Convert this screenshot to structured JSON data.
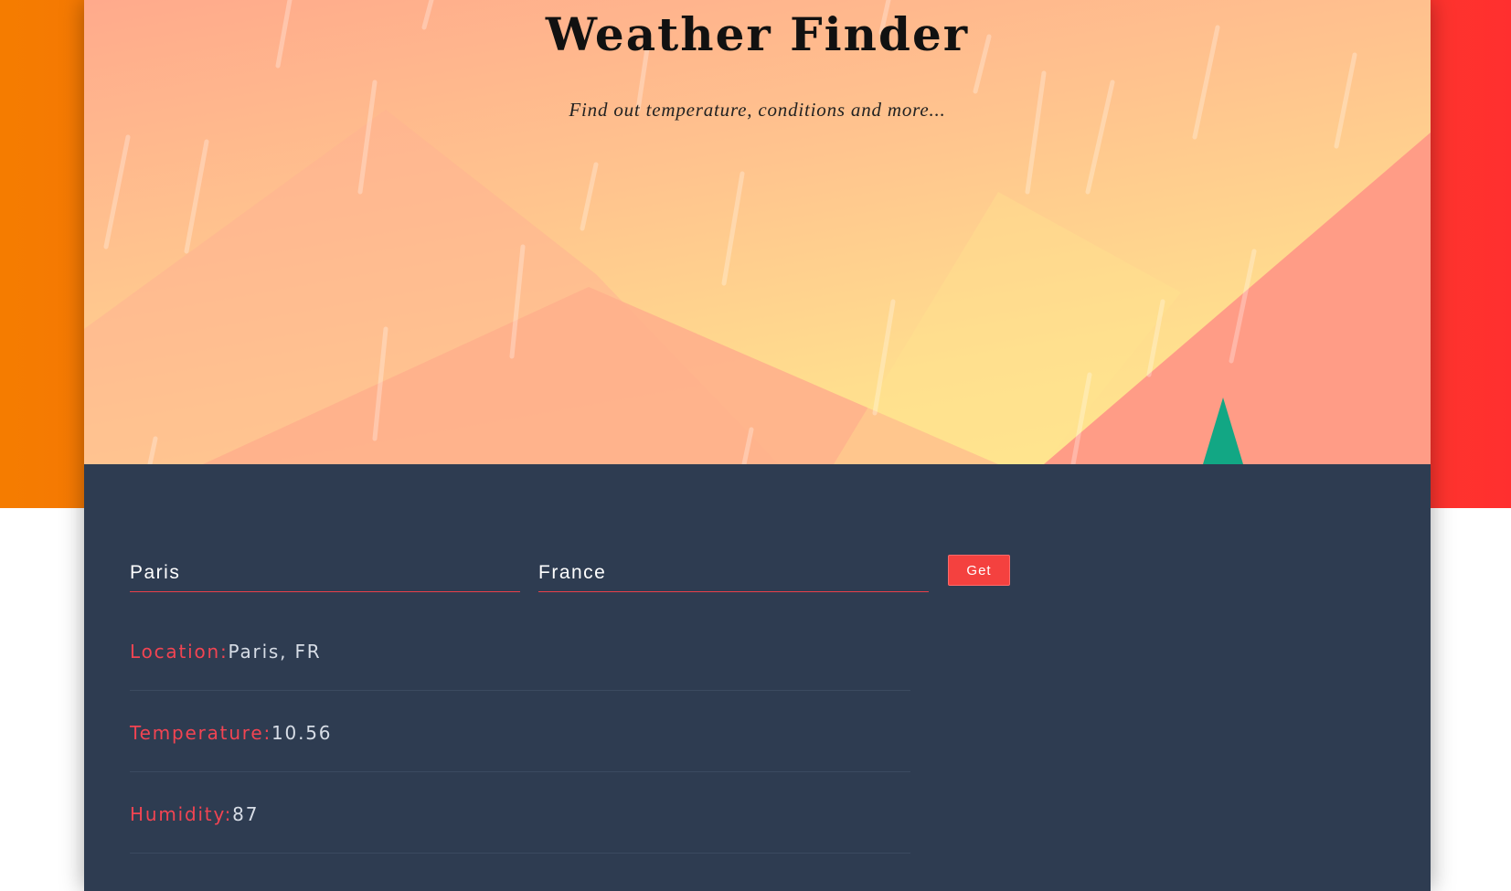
{
  "header": {
    "title": "Weather Finder",
    "subtitle": "Find out temperature, conditions and more..."
  },
  "form": {
    "city_value": "Paris",
    "country_value": "France",
    "submit_label": "Get"
  },
  "results": {
    "location": {
      "label": "Location:",
      "value": "Paris, FR"
    },
    "temperature": {
      "label": "Temperature:",
      "value": "10.56"
    },
    "humidity": {
      "label": "Humidity:",
      "value": "87"
    }
  },
  "colors": {
    "accent": "#f4413f",
    "panel": "#2e3c51",
    "label": "#f24452"
  }
}
